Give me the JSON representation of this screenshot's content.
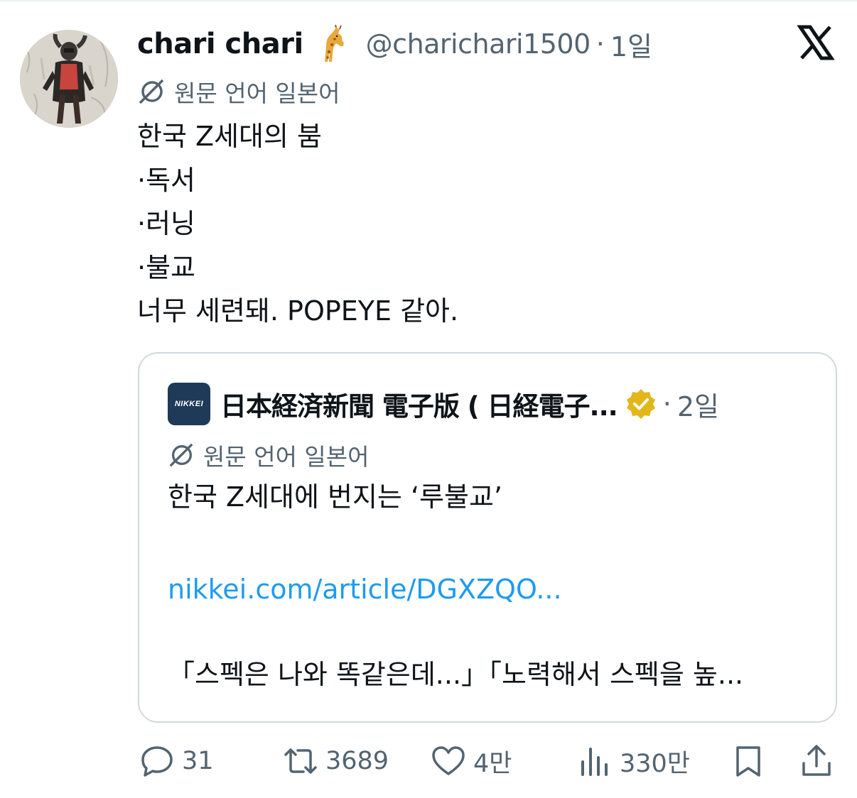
{
  "post": {
    "display_name": "chari chari",
    "name_emoji": "giraffe",
    "handle": "@charichari1500",
    "separator": "·",
    "time": "1일",
    "translation_label": "원문 언어 일본어",
    "body_lines": [
      "한국 Z세대의 붐",
      "·독서",
      "·러닝",
      "·불교",
      "너무 세련돼. POPEYE 같아."
    ]
  },
  "quoted": {
    "logo_text": "NIKKEI",
    "name": "日本経済新聞 電子版 ( 日経電子...",
    "verified_badge_color": "#e2b719",
    "separator": "·",
    "time": "2일",
    "translation_label": "원문 언어 일본어",
    "text": "한국 Z세대에 번지는 ‘루불교’",
    "link": "nikkei.com/article/DGXZQO...",
    "snippet": "「스펙은 나와 똑같은데...」「노력해서 스펙을 높..."
  },
  "actions": {
    "replies": "31",
    "reposts": "3689",
    "likes": "4만",
    "views": "330만"
  },
  "colors": {
    "text_primary": "#0f1419",
    "text_secondary": "#536471",
    "link": "#1d9bf0",
    "border": "#cfd9de",
    "nikkei_navy": "#1f3a59"
  },
  "icons": {
    "platform": "x-logo-icon",
    "translate": "translate-icon",
    "reply": "reply-icon",
    "repost": "repost-icon",
    "like": "heart-icon",
    "views": "views-icon",
    "bookmark": "bookmark-icon",
    "share": "share-icon"
  }
}
